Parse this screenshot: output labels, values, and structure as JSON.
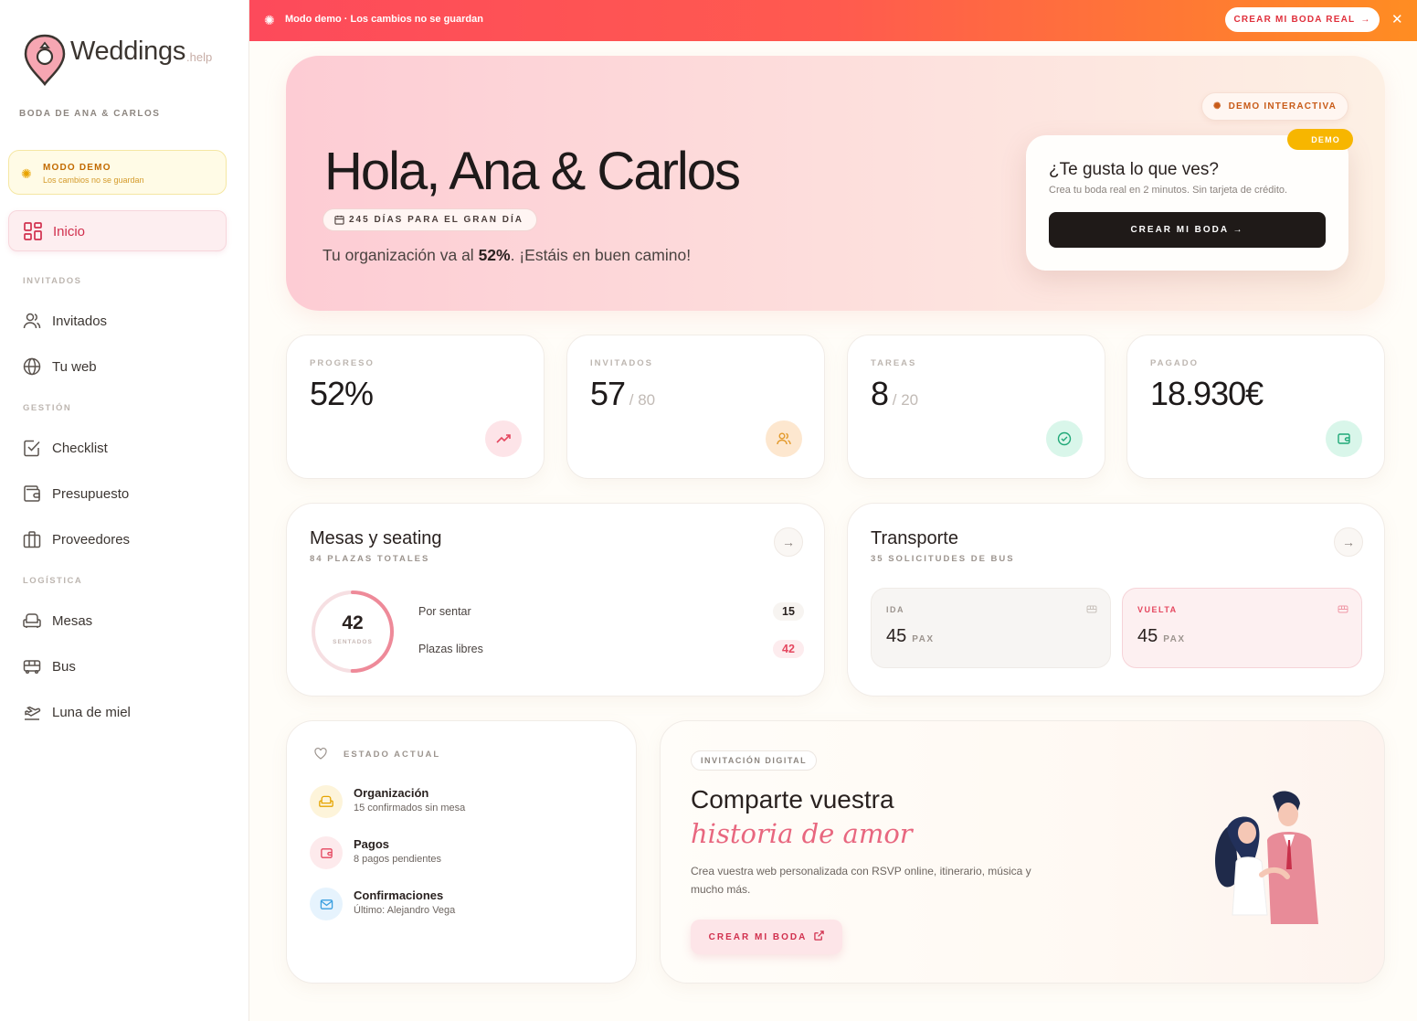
{
  "banner": {
    "text": "Modo demo · Los cambios no se guardan",
    "cta": "CREAR MI BODA REAL",
    "close": "✕"
  },
  "sidebar": {
    "logo_word": "Weddings",
    "logo_suffix": ".help",
    "wedding_name": "BODA DE ANA & CARLOS",
    "demo_title": "MODO DEMO",
    "demo_sub": "Los cambios no se guardan",
    "active_item": "Inicio",
    "sections": {
      "invitados": "INVITADOS",
      "gestion": "GESTIÓN",
      "logistica": "LOGÍSTICA"
    },
    "items": {
      "invitados": "Invitados",
      "tuweb": "Tu web",
      "checklist": "Checklist",
      "presupuesto": "Presupuesto",
      "proveedores": "Proveedores",
      "mesas": "Mesas",
      "bus": "Bus",
      "luna": "Luna de miel"
    }
  },
  "hero": {
    "greeting": "Hola, Ana & Carlos",
    "days": "245 DÍAS PARA EL GRAN DÍA",
    "org_prefix": "Tu organización va al ",
    "org_pct": "52%",
    "org_suffix": ". ¡Estáis en buen camino!",
    "demo_pill": "DEMO INTERACTIVA",
    "card_badge": "DEMO",
    "card_q": "¿Te gusta lo que ves?",
    "card_sub": "Crea tu boda real en 2 minutos. Sin tarjeta de crédito.",
    "card_btn": "CREAR MI BODA →"
  },
  "stats": [
    {
      "label": "PROGRESO",
      "value": "52%",
      "sub": "",
      "icon": "trend-up-icon",
      "color": "#fde4e8"
    },
    {
      "label": "INVITADOS",
      "value": "57",
      "sub": " / 80",
      "icon": "users-icon",
      "color": "#fdebd6"
    },
    {
      "label": "TAREAS",
      "value": "8",
      "sub": " / 20",
      "icon": "check-circle-icon",
      "color": "#dcf7ee"
    },
    {
      "label": "PAGADO",
      "value": "18.930€",
      "sub": "",
      "icon": "wallet-icon",
      "color": "#dcf7ee"
    }
  ],
  "mesas": {
    "title": "Mesas y seating",
    "sub": "84 PLAZAS TOTALES",
    "seated": "42",
    "seated_label": "SENTADOS",
    "seated_fraction": 0.5,
    "rows": [
      {
        "label": "Por sentar",
        "value": "15"
      },
      {
        "label": "Plazas libres",
        "value": "42"
      }
    ]
  },
  "transporte": {
    "title": "Transporte",
    "sub": "35 SOLICITUDES DE BUS",
    "ida_label": "IDA",
    "ida_value": "45",
    "vuelta_label": "VUELTA",
    "vuelta_value": "45",
    "unit": "PAX"
  },
  "estado": {
    "title": "ESTADO ACTUAL",
    "items": [
      {
        "title": "Organización",
        "sub": "15 confirmados sin mesa"
      },
      {
        "title": "Pagos",
        "sub": "8 pagos pendientes"
      },
      {
        "title": "Confirmaciones",
        "sub": "Último: Alejandro Vega"
      }
    ]
  },
  "invitacion": {
    "pill": "INVITACIÓN DIGITAL",
    "h1": "Comparte vuestra",
    "h2": "historia de amor",
    "p": "Crea vuestra web personalizada con RSVP online, itinerario, música y mucho más.",
    "btn": "CREAR MI BODA"
  },
  "colors": {
    "accent": "#d1304e",
    "banner_start": "#fd4a5b",
    "banner_end": "#ff8d22"
  }
}
